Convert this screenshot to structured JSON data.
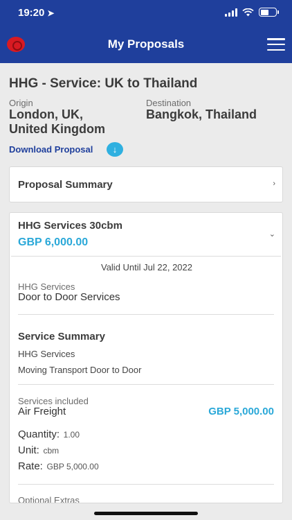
{
  "status": {
    "time": "19:20"
  },
  "header": {
    "title": "My Proposals"
  },
  "proposal": {
    "heading": "HHG - Service: UK to Thailand",
    "origin_label": "Origin",
    "origin_line1": "London, UK,",
    "origin_line2": "United Kingdom",
    "destination_label": "Destination",
    "destination_value": "Bangkok, Thailand",
    "download_label": "Download Proposal"
  },
  "summary": {
    "label": "Proposal Summary"
  },
  "service": {
    "title": "HHG Services 30cbm",
    "price": "GBP 6,000.00",
    "valid_until": "Valid Until Jul 22, 2022",
    "category_label": "HHG Services",
    "category_value": "Door to Door Services",
    "summary_heading": "Service Summary",
    "summary_line1": "HHG Services",
    "summary_line2": "Moving Transport Door to Door",
    "included_label": "Services included",
    "included_name": "Air Freight",
    "included_price": "GBP 5,000.00",
    "quantity_label": "Quantity:",
    "quantity_value": "1.00",
    "unit_label": "Unit:",
    "unit_value": "cbm",
    "rate_label": "Rate:",
    "rate_value": "GBP 5,000.00",
    "optional_label": "Optional Extras"
  }
}
